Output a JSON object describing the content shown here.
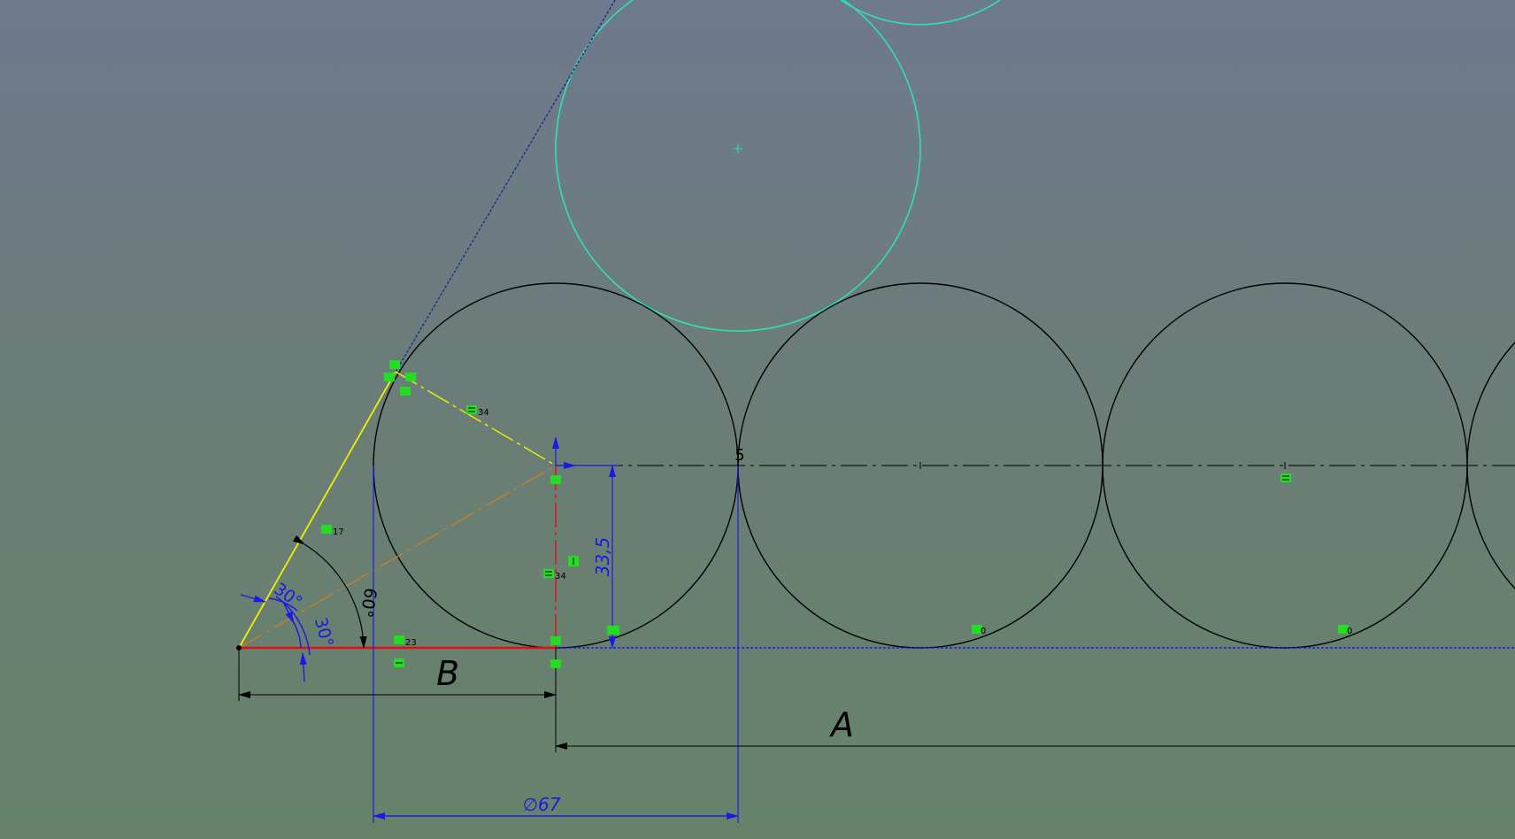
{
  "sketch": {
    "dimensions": {
      "diameter": "∅67",
      "height": "33,5",
      "angle_60": "60°",
      "angle_30_a": "30°",
      "angle_30_b": "30°",
      "label_A": "A",
      "label_B": "B",
      "label_5": "5"
    },
    "relation_tags": {
      "equal_34_a": "34",
      "equal_34_b": "34",
      "parallel_17": "17",
      "parallel_23": "23",
      "coincident_0_a": "0",
      "coincident_0_b": "0"
    },
    "colors": {
      "background_top": "#6e7a8e",
      "background_bottom": "#66836a",
      "geometry": "#000000",
      "construction_circle": "#30e0b0",
      "dimension": "#1a1ae6",
      "fixed_line": "#e01010",
      "selected_line": "#f0f000",
      "centerline": "#d08020",
      "relation_icon": "#22dd22"
    }
  }
}
